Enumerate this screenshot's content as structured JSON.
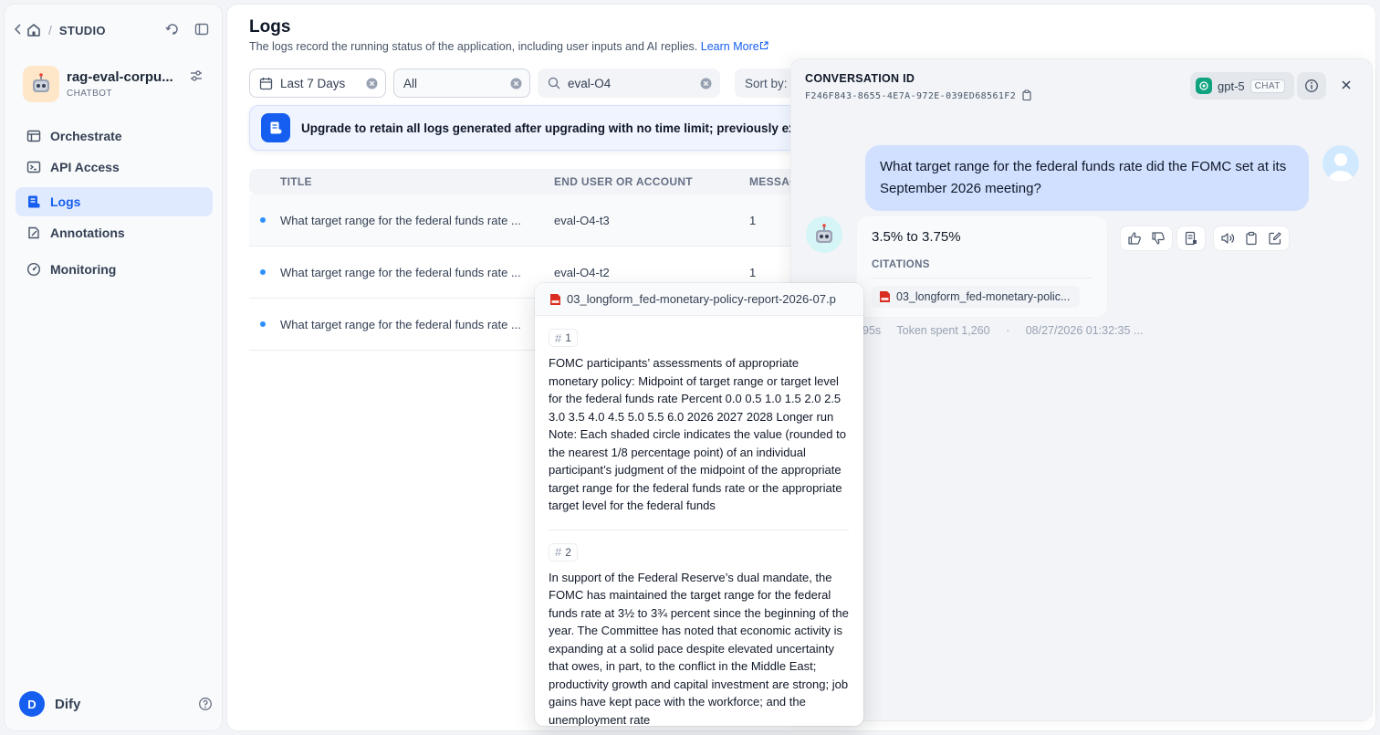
{
  "breadcrumb": {
    "label": "STUDIO"
  },
  "app": {
    "name": "rag-eval-corpu...",
    "type": "CHATBOT"
  },
  "nav": {
    "items": [
      {
        "label": "Orchestrate"
      },
      {
        "label": "API Access"
      },
      {
        "label": "Logs",
        "active": true
      },
      {
        "label": "Annotations"
      },
      {
        "label": "Monitoring"
      }
    ]
  },
  "user": {
    "initial": "D",
    "name": "Dify"
  },
  "page": {
    "title": "Logs",
    "description": "The logs record the running status of the application, including user inputs and AI replies.",
    "learn_more": "Learn More"
  },
  "filters": {
    "date": "Last 7 Days",
    "status": "All",
    "search_value": "eval-O4",
    "sort_label": "Sort by:"
  },
  "banner": {
    "text": "Upgrade to retain all logs generated after upgrading with no time limit; previously expir"
  },
  "table": {
    "headers": [
      "TITLE",
      "END USER OR ACCOUNT",
      "MESSAG"
    ],
    "rows": [
      {
        "title": "What target range for the federal funds rate ...",
        "user": "eval-O4-t3",
        "messages": "1"
      },
      {
        "title": "What target range for the federal funds rate ...",
        "user": "eval-O4-t2",
        "messages": "1"
      },
      {
        "title": "What target range for the federal funds rate ...",
        "user": "",
        "messages": ""
      }
    ]
  },
  "conversation": {
    "label": "CONVERSATION ID",
    "id": "F246F843-8655-4E7A-972E-039ED68561F2",
    "model": {
      "name": "gpt-5",
      "badge": "CHAT"
    },
    "question": "What target range for the federal funds rate did the FOMC set at its September 2026 meeting?",
    "answer": "3.5% to 3.75%",
    "citations_label": "CITATIONS",
    "citation_file": "03_longform_fed-monetary-polic...",
    "meta": {
      "latency": "95s",
      "tokens": "Token spent 1,260",
      "separator": "·",
      "timestamp": "08/27/2026 01:32:35 ..."
    }
  },
  "popover": {
    "file": "03_longform_fed-monetary-policy-report-2026-07.p",
    "segments": [
      {
        "no": "1",
        "text": "FOMC participants’ assessments of appropriate monetary policy: Midpoint of target range or target level for the federal funds rate Percent 0.0 0.5 1.0 1.5 2.0 2.5 3.0 3.5 4.0 4.5 5.0 5.5 6.0 2026 2027 2028 Longer run Note: Each shaded circle indicates the value (rounded to the nearest 1/8 percentage point) of an individual participant’s judgment of the midpoint of the appropriate target range for the federal funds rate or the appropriate target level for the federal funds"
      },
      {
        "no": "2",
        "text": "In support of the Federal Reserve’s dual mandate, the FOMC has maintained the target range for the federal funds rate at 3½ to 3¾ percent since the beginning of the year. The Committee has noted that economic activity is expanding at a solid pace despite elevated uncertainty that owes, in part, to the conflict in the Middle East; productivity growth and capital investment are strong; job gains have kept pace with the workforce; and the unemployment rate"
      }
    ]
  },
  "colors": {
    "accent": "#155eef",
    "active_nav_bg": "#e0eaff",
    "question_bubble": "#d1e0ff",
    "pdf_red": "#d92d20"
  }
}
